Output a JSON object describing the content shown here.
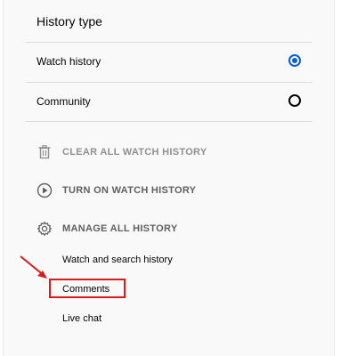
{
  "history_type": {
    "title": "History type",
    "options": [
      {
        "label": "Watch history",
        "selected": true
      },
      {
        "label": "Community",
        "selected": false
      }
    ]
  },
  "actions": {
    "clear": {
      "label": "CLEAR ALL WATCH HISTORY",
      "icon": "trash-icon"
    },
    "turn_on": {
      "label": "TURN ON WATCH HISTORY",
      "icon": "play-circle-icon"
    },
    "manage": {
      "label": "MANAGE ALL HISTORY",
      "icon": "gear-icon"
    }
  },
  "manage_links": [
    {
      "label": "Watch and search history"
    },
    {
      "label": "Comments"
    },
    {
      "label": "Live chat"
    }
  ],
  "colors": {
    "accent": "#065fd4",
    "annotation": "#d91c1c"
  }
}
